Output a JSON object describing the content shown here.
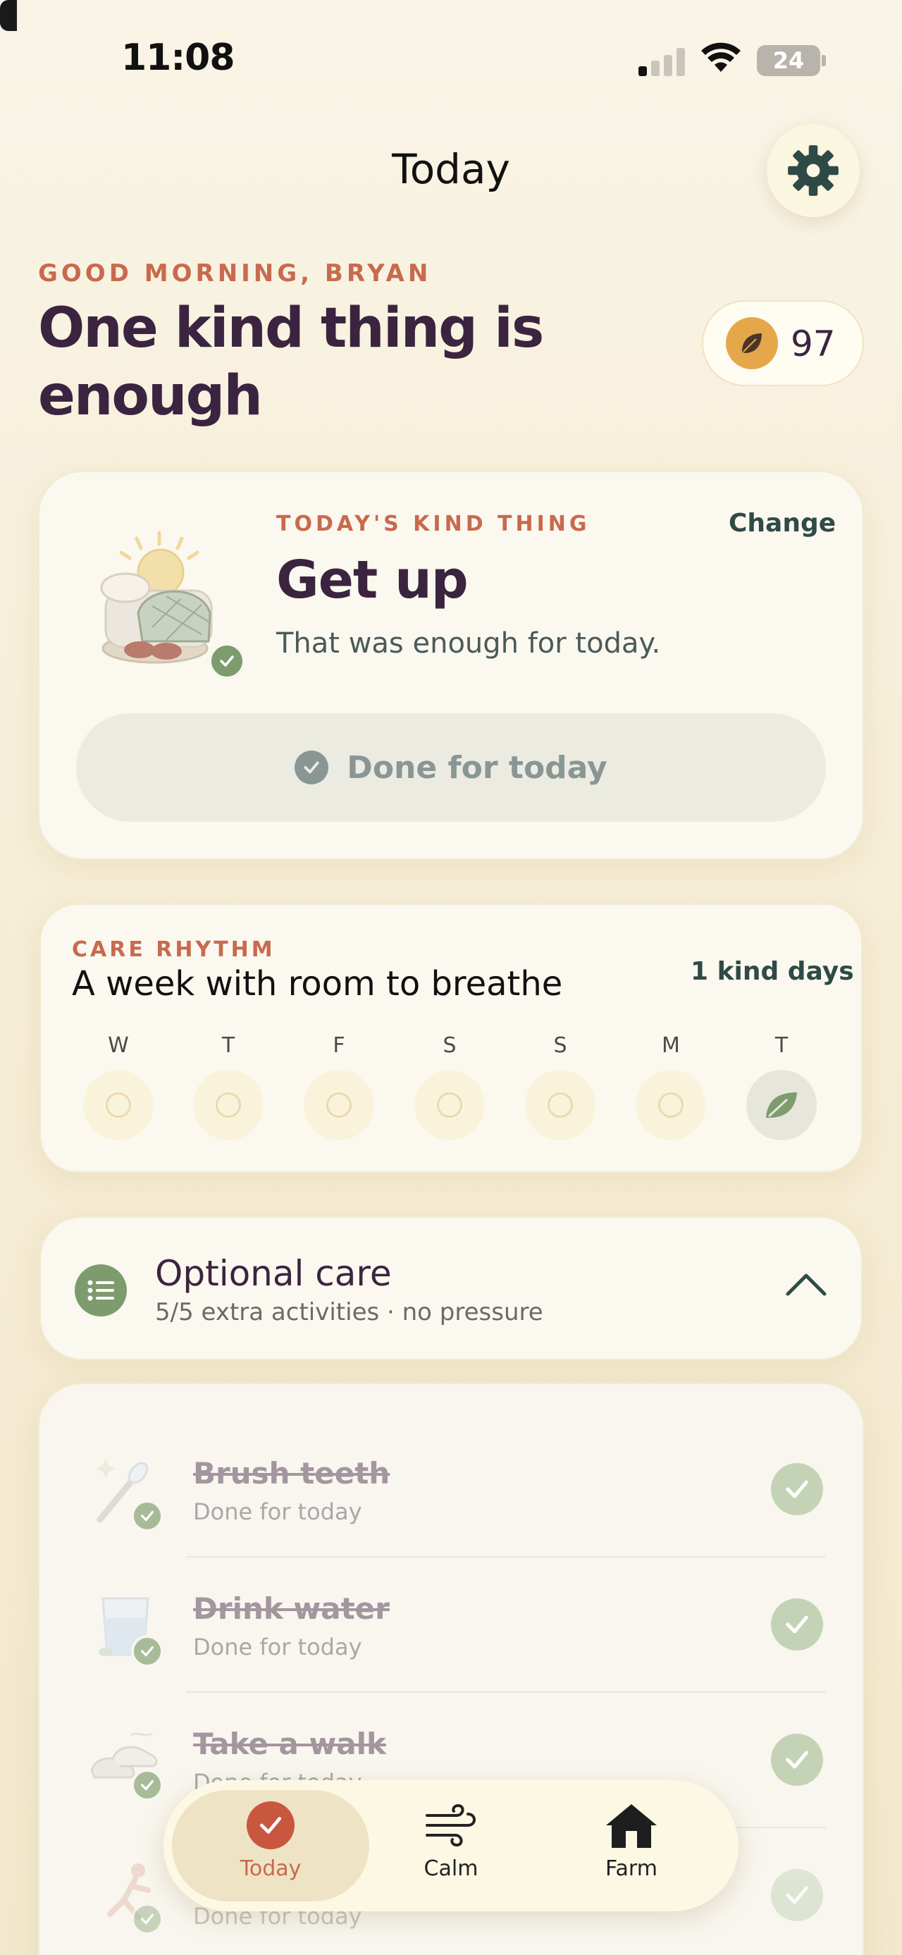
{
  "status_bar": {
    "time": "11:08",
    "battery": "24"
  },
  "header": {
    "title": "Today"
  },
  "greeting": "GOOD MORNING, BRYAN",
  "headline": "One kind thing is enough",
  "points": {
    "value": "97"
  },
  "kind_thing": {
    "label": "TODAY'S KIND THING",
    "change_label": "Change",
    "title": "Get up",
    "subtitle": "That was enough for today.",
    "done_label": "Done for today"
  },
  "rhythm": {
    "label": "CARE RHYTHM",
    "title": "A week with room to breathe",
    "count": "1 kind days",
    "days": [
      {
        "letter": "W",
        "done": false
      },
      {
        "letter": "T",
        "done": false
      },
      {
        "letter": "F",
        "done": false
      },
      {
        "letter": "S",
        "done": false
      },
      {
        "letter": "S",
        "done": false
      },
      {
        "letter": "M",
        "done": false
      },
      {
        "letter": "T",
        "done": true
      }
    ]
  },
  "optional": {
    "title": "Optional care",
    "subtitle": "5/5 extra activities · no pressure"
  },
  "activities": [
    {
      "title": "Brush teeth",
      "status": "Done for today",
      "icon": "toothbrush-icon"
    },
    {
      "title": "Drink water",
      "status": "Done for today",
      "icon": "water-glass-icon"
    },
    {
      "title": "Take a walk",
      "status": "Done for today",
      "icon": "sneakers-icon"
    },
    {
      "title": "",
      "status": "Done for today",
      "icon": "stretch-icon"
    }
  ],
  "nav": {
    "items": [
      {
        "label": "Today",
        "icon": "check-circle-icon",
        "active": true
      },
      {
        "label": "Calm",
        "icon": "wind-icon",
        "active": false
      },
      {
        "label": "Farm",
        "icon": "house-icon",
        "active": false
      }
    ]
  },
  "colors": {
    "accent": "#c86a4e",
    "headline": "#3b2440",
    "green": "#7e9b6e",
    "gold": "#e4a84a"
  }
}
